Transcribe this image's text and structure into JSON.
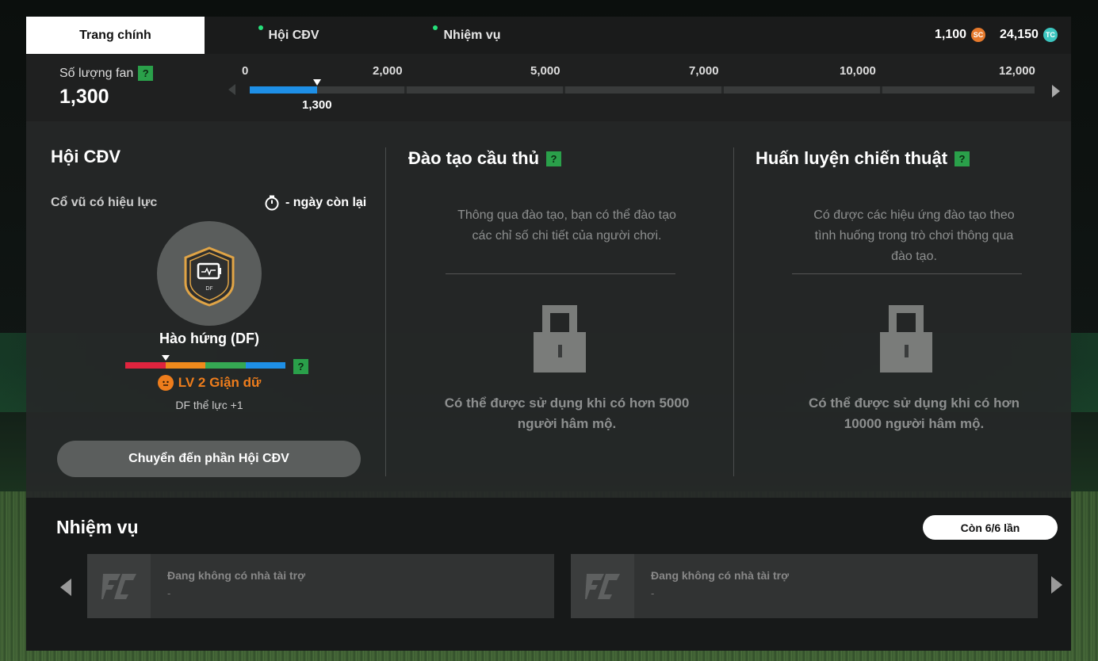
{
  "tabs": [
    {
      "label": "Trang chính",
      "active": true,
      "notification": false
    },
    {
      "label": "Hội CĐV",
      "active": false,
      "notification": true
    },
    {
      "label": "Nhiệm vụ",
      "active": false,
      "notification": true
    }
  ],
  "currency": {
    "sc_amount": "1,100",
    "sc_icon": "SC",
    "tc_amount": "24,150",
    "tc_icon": "TC"
  },
  "fans": {
    "label": "Số lượng fan",
    "help": "?",
    "count": "1,300",
    "ticks": [
      "0",
      "2,000",
      "5,000",
      "7,000",
      "10,000",
      "12,000"
    ],
    "current_marker": "1,300",
    "progress_value": 1300
  },
  "supporters": {
    "title": "Hội CĐV",
    "boost_label": "Cổ vũ có hiệu lực",
    "remaining": "- ngày còn lại",
    "badge_pos": "DF",
    "mood_name": "Hào hứng (DF)",
    "mood_colors": [
      "#e0243e",
      "#ef8a1c",
      "#35a853",
      "#1e8fe6"
    ],
    "help": "?",
    "level_text": "LV 2 Giận dữ",
    "effect": "DF thể lực +1",
    "goto_button": "Chuyển đến phần Hội CĐV"
  },
  "training": {
    "title": "Đào tạo cầu thủ",
    "help": "?",
    "desc_line1": "Thông qua đào tạo, bạn có thể đào tạo",
    "desc_line2": "các chỉ số chi tiết của người chơi.",
    "unlock_line1": "Có thể được sử dụng khi có hơn 5000",
    "unlock_line2": "người hâm mộ."
  },
  "tactics": {
    "title": "Huấn luyện chiến thuật",
    "help": "?",
    "desc_line1": "Có được các hiệu ứng đào tạo theo",
    "desc_line2": "tình huống trong trò chơi thông qua",
    "desc_line3": "đào tạo.",
    "unlock_line1": "Có thể được sử dụng khi có hơn",
    "unlock_line2": "10000 người hâm mộ."
  },
  "missions": {
    "title": "Nhiệm vụ",
    "remaining_pill": "Còn 6/6 lần",
    "cards": [
      {
        "sponsor": "Đang không có nhà tài trợ",
        "sub": "-"
      },
      {
        "sponsor": "Đang không có nhà tài trợ",
        "sub": "-"
      }
    ]
  }
}
